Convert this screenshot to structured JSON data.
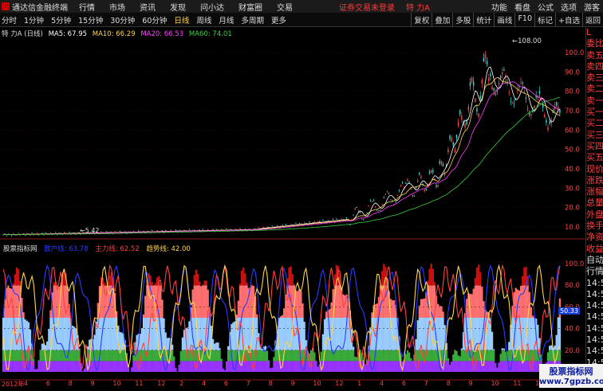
{
  "topbar": {
    "title": "通达信金融终端",
    "menus": [
      "行情",
      "市场",
      "资讯",
      "发现",
      "问小达",
      "财富圈",
      "交易"
    ],
    "login_status": "证券交易未登录",
    "stock_name": "特 力A",
    "right": [
      "功能",
      "看盘",
      "公式",
      "选项",
      "游客"
    ]
  },
  "periods": [
    "分时",
    "1分钟",
    "5分钟",
    "15分钟",
    "30分钟",
    "60分钟",
    "日线",
    "周线",
    "月线",
    "多周期",
    "更多"
  ],
  "selected_period": "日线",
  "toolbar_right": [
    "复权",
    "叠加",
    "多股",
    "统计",
    "画线",
    "F10",
    "标记",
    "+自选",
    "返回"
  ],
  "main_chart": {
    "legend_name": "特 力A (日线)",
    "ma": [
      {
        "label": "MA5: 67.95",
        "color": "#ffffff"
      },
      {
        "label": "MA10: 66.29",
        "color": "#ffd54f"
      },
      {
        "label": "MA20: 66.53",
        "color": "#ff40ff"
      },
      {
        "label": "MA60: 74.01",
        "color": "#3cd03c"
      }
    ],
    "price_ticks": [
      "100.0",
      "90.0",
      "80.0",
      "70.0",
      "60.0",
      "50.0",
      "40.0",
      "30.0",
      "20.0",
      "10.0"
    ],
    "high_label": "108.00",
    "low_label": "5.42"
  },
  "sub_chart": {
    "title": "股票指标网",
    "labels": [
      {
        "label": "散户线: 63.78",
        "color": "#2a3cff"
      },
      {
        "label": "主力线: 62.52",
        "color": "#ff4040"
      },
      {
        "label": "趋势线: 42.00",
        "color": "#ffd54f"
      }
    ],
    "ticks": [
      "100.0",
      "80.0",
      "60.0",
      "40.0",
      "20.0"
    ],
    "current_value": "50.33"
  },
  "sidebar": [
    "L",
    "委比",
    "卖五",
    "卖四",
    "卖三",
    "卖二",
    "卖一",
    "买一",
    "买二",
    "买三",
    "买四",
    "买五",
    "现价",
    "涨跌",
    "涨幅",
    "总量",
    "外盘",
    "换手",
    "净资",
    "收益",
    "自动",
    "行情",
    "14:5",
    "14:5",
    "14:5",
    "14:5",
    "14:5",
    "14:5",
    "14:5",
    "14:5",
    "14:5"
  ],
  "x_axis": [
    "2012年",
    "4",
    "6",
    "8",
    "9",
    "10",
    "11",
    "12",
    "2",
    "4",
    "6",
    "7",
    "8",
    "9",
    "10",
    "12",
    "1",
    "4",
    "6",
    "7",
    "8",
    "9",
    "10",
    "11",
    "12",
    "2"
  ],
  "watermark": {
    "line1": "股票指标网",
    "line2": "www.7gpzb.com"
  }
}
